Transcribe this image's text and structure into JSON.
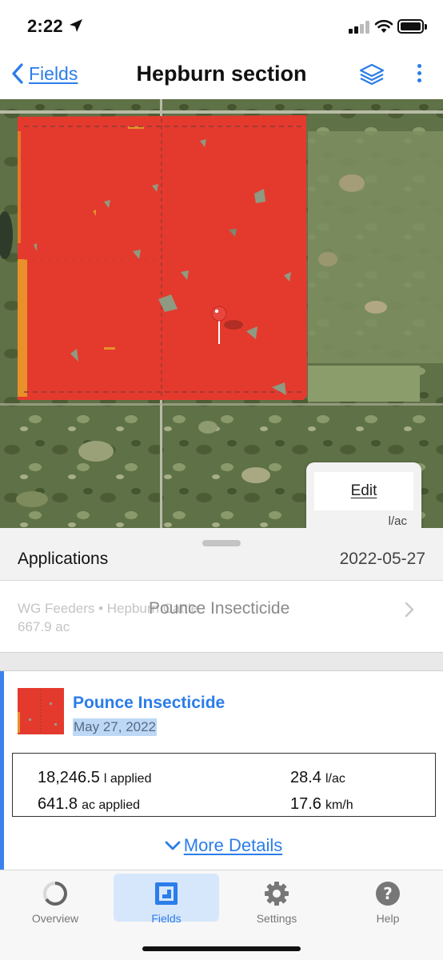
{
  "status_bar": {
    "time": "2:22"
  },
  "nav": {
    "back_label": "Fields",
    "title": "Hepburn section"
  },
  "map": {
    "edit_label": "Edit",
    "unit_label": "l/ac",
    "coverage_color": "#e43a2e",
    "edge_color": "#e8902a"
  },
  "applications": {
    "title": "Applications",
    "date": "2022-05-27",
    "row": {
      "farm_field": "WG Feeders • Hepburn Cattle",
      "area": "667.9 ac",
      "product": "Pounce Insecticide"
    }
  },
  "detail": {
    "product_name": "Pounce Insecticide",
    "date": "May 27, 2022",
    "stats": {
      "applied_volume": {
        "value": "18,246.5",
        "unit": "l applied"
      },
      "rate": {
        "value": "28.4",
        "unit": "l/ac"
      },
      "applied_area": {
        "value": "641.8",
        "unit": "ac applied"
      },
      "speed": {
        "value": "17.6",
        "unit": "km/h"
      }
    },
    "more_details_label": "More Details"
  },
  "tabs": [
    {
      "label": "Overview",
      "icon": "overview-icon"
    },
    {
      "label": "Fields",
      "icon": "fields-icon",
      "active": true
    },
    {
      "label": "Settings",
      "icon": "gear-icon"
    },
    {
      "label": "Help",
      "icon": "help-icon"
    }
  ],
  "colors": {
    "accent": "#2b7de9",
    "active_tab_bg": "#d7e7fb"
  }
}
